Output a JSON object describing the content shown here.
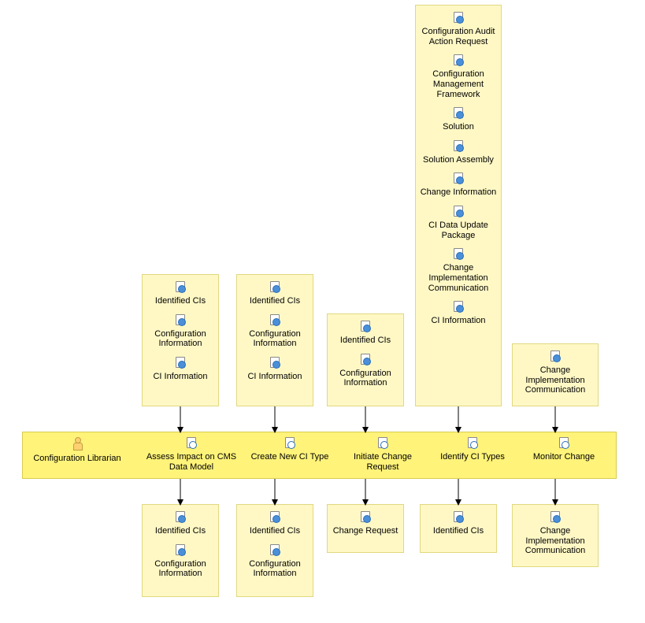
{
  "lane": {
    "actor": "Configuration Librarian",
    "activities": [
      "Assess Impact on CMS Data Model",
      "Create New CI Type",
      "Initiate Change Request",
      "Identify CI Types",
      "Monitor Change"
    ]
  },
  "inputs": {
    "col1": [
      "Identified CIs",
      "Configuration Information",
      "CI Information"
    ],
    "col2": [
      "Identified CIs",
      "Configuration Information",
      "CI Information"
    ],
    "col3": [
      "Identified CIs",
      "Configuration Information"
    ],
    "col4": [
      "Configuration Audit Action Request",
      "Configuration Management Framework",
      "Solution",
      "Solution Assembly",
      "Change Information",
      "CI Data Update Package",
      "Change Implementation Communication",
      "CI Information"
    ],
    "col5": [
      "Change Implementation Communication"
    ]
  },
  "outputs": {
    "col1": [
      "Identified CIs",
      "Configuration Information"
    ],
    "col2": [
      "Identified CIs",
      "Configuration Information"
    ],
    "col3": [
      "Change Request"
    ],
    "col4": [
      "Identified CIs"
    ],
    "col5": [
      "Change Implementation Communication"
    ]
  }
}
